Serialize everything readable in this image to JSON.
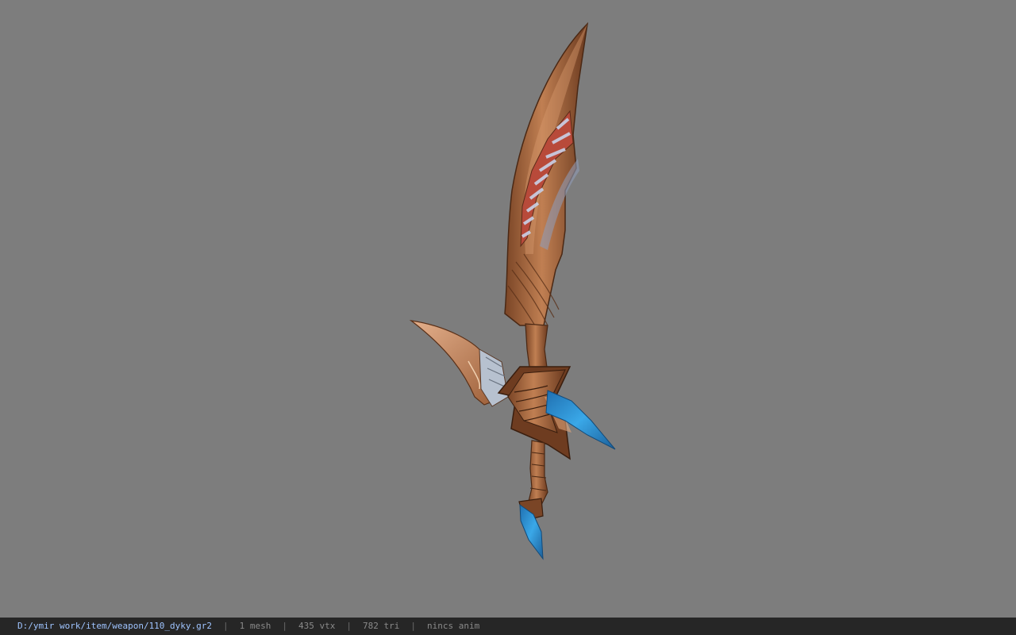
{
  "viewport": {
    "background": "#7d7d7d",
    "model_icon": "curved-sword-model"
  },
  "statusbar": {
    "file_path": "D:/ymir work/item/weapon/110_dyky.gr2",
    "separator": "|",
    "mesh_count": "1 mesh",
    "vertex_count": "435 vtx",
    "triangle_count": "782 tri",
    "animation": "nincs anim",
    "path_color": "#9fc4ff",
    "text_color": "#8a8a8a",
    "background": "#262626"
  }
}
